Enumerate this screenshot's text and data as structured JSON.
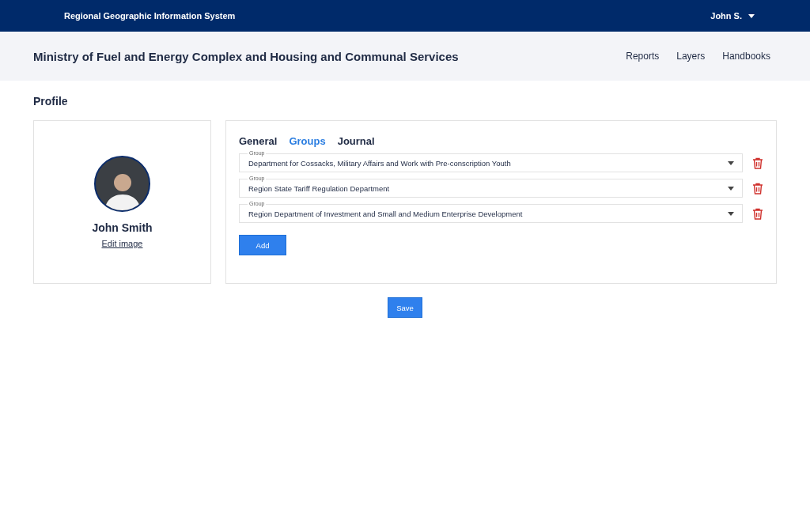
{
  "top_bar": {
    "system_title": "Regional Geographic Information System",
    "user": "John S."
  },
  "header": {
    "title": "Ministry of Fuel and Energy Complex and Housing and Communal Services",
    "nav": [
      "Reports",
      "Layers",
      "Handbooks"
    ]
  },
  "page_title": "Profile",
  "profile": {
    "name": "John Smith",
    "edit_link": "Edit image"
  },
  "tabs": [
    {
      "label": "General",
      "selected": false
    },
    {
      "label": "Groups",
      "selected": true
    },
    {
      "label": "Journal",
      "selected": false
    }
  ],
  "groups": [
    {
      "label": "Group",
      "value": "Department for Cossacks, Military Affairs and Work with Pre-conscription Youth"
    },
    {
      "label": "Group",
      "value": "Region State Tariff Regulation Department"
    },
    {
      "label": "Group",
      "value": "Region Department of Investment and Small and Medium Enterprise Development"
    }
  ],
  "add_button": "Add",
  "save_button": "Save"
}
